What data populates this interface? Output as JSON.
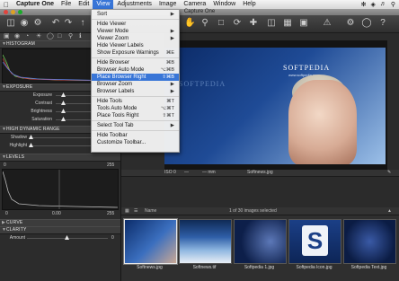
{
  "menubar": {
    "app": "Capture One",
    "items": [
      "File",
      "Edit",
      "View",
      "Adjustments",
      "Image",
      "Camera",
      "Window",
      "Help"
    ]
  },
  "window_title": "Capture One",
  "panel_sections": {
    "histogram": "HISTOGRAM",
    "exposure": "EXPOSURE",
    "hdr": "HIGH DYNAMIC RANGE",
    "levels": "LEVELS",
    "curve": "CURVE",
    "clarity": "CLARITY"
  },
  "exposure": {
    "rows": [
      "Exposure",
      "Contrast",
      "Brightness",
      "Saturation"
    ]
  },
  "hdr": {
    "rows": [
      "Shadow",
      "Highlight"
    ]
  },
  "levels": {
    "left": "0",
    "right": "255",
    "bottom_left": "0",
    "bottom_mid": "0.00",
    "bottom_right": "255"
  },
  "clarity": {
    "rows": [
      "Amount"
    ],
    "value": "0"
  },
  "viewer": {
    "iso": "ISO 0",
    "shutter": "—",
    "aperture": "— mm",
    "filename": "Softnews.jpg",
    "brand": "SOFTPEDIA",
    "brand_url": "www.softpedia.com",
    "ghost_brand": "SOFTPEDIA"
  },
  "filmstrip_bar": {
    "sort_label": "Name",
    "count": "1 of 30 images selected"
  },
  "thumbs": [
    {
      "caption": "Softnews.jpg"
    },
    {
      "caption": "Softnews.tif"
    },
    {
      "caption": "Softpedia 1.jpg"
    },
    {
      "caption": "Softpedia Icon.jpg"
    },
    {
      "caption": "Softpedia Text.jpg"
    }
  ],
  "view_menu": {
    "items": [
      {
        "label": "Sort",
        "key": "▶",
        "highlight": false
      },
      {
        "label": "Hide Viewer",
        "key": "",
        "highlight": false
      },
      {
        "label": "Viewer Mode",
        "key": "▶",
        "highlight": false
      },
      {
        "label": "Viewer Zoom",
        "key": "▶",
        "highlight": false
      },
      {
        "label": "Hide Viewer Labels",
        "key": "",
        "highlight": false
      },
      {
        "label": "Show Exposure Warnings",
        "key": "⌘E",
        "highlight": false
      },
      {
        "label": "Hide Browser",
        "key": "⌘B",
        "highlight": false
      },
      {
        "label": "Browser Auto Mode",
        "key": "⌥⌘B",
        "highlight": false
      },
      {
        "label": "Place Browser Right",
        "key": "⇧⌘B",
        "highlight": true
      },
      {
        "label": "Browser Zoom",
        "key": "▶",
        "highlight": false
      },
      {
        "label": "Browser Labels",
        "key": "▶",
        "highlight": false
      },
      {
        "label": "Hide Tools",
        "key": "⌘T",
        "highlight": false
      },
      {
        "label": "Tools Auto Mode",
        "key": "⌥⌘T",
        "highlight": false
      },
      {
        "label": "Place Tools Right",
        "key": "⇧⌘T",
        "highlight": false
      },
      {
        "label": "Select Tool Tab",
        "key": "▶",
        "highlight": false
      },
      {
        "label": "Hide Toolbar",
        "key": "",
        "highlight": false
      },
      {
        "label": "Customize Toolbar...",
        "key": "",
        "highlight": false
      }
    ]
  },
  "colors": {
    "menu_highlight": "#3875d7"
  }
}
